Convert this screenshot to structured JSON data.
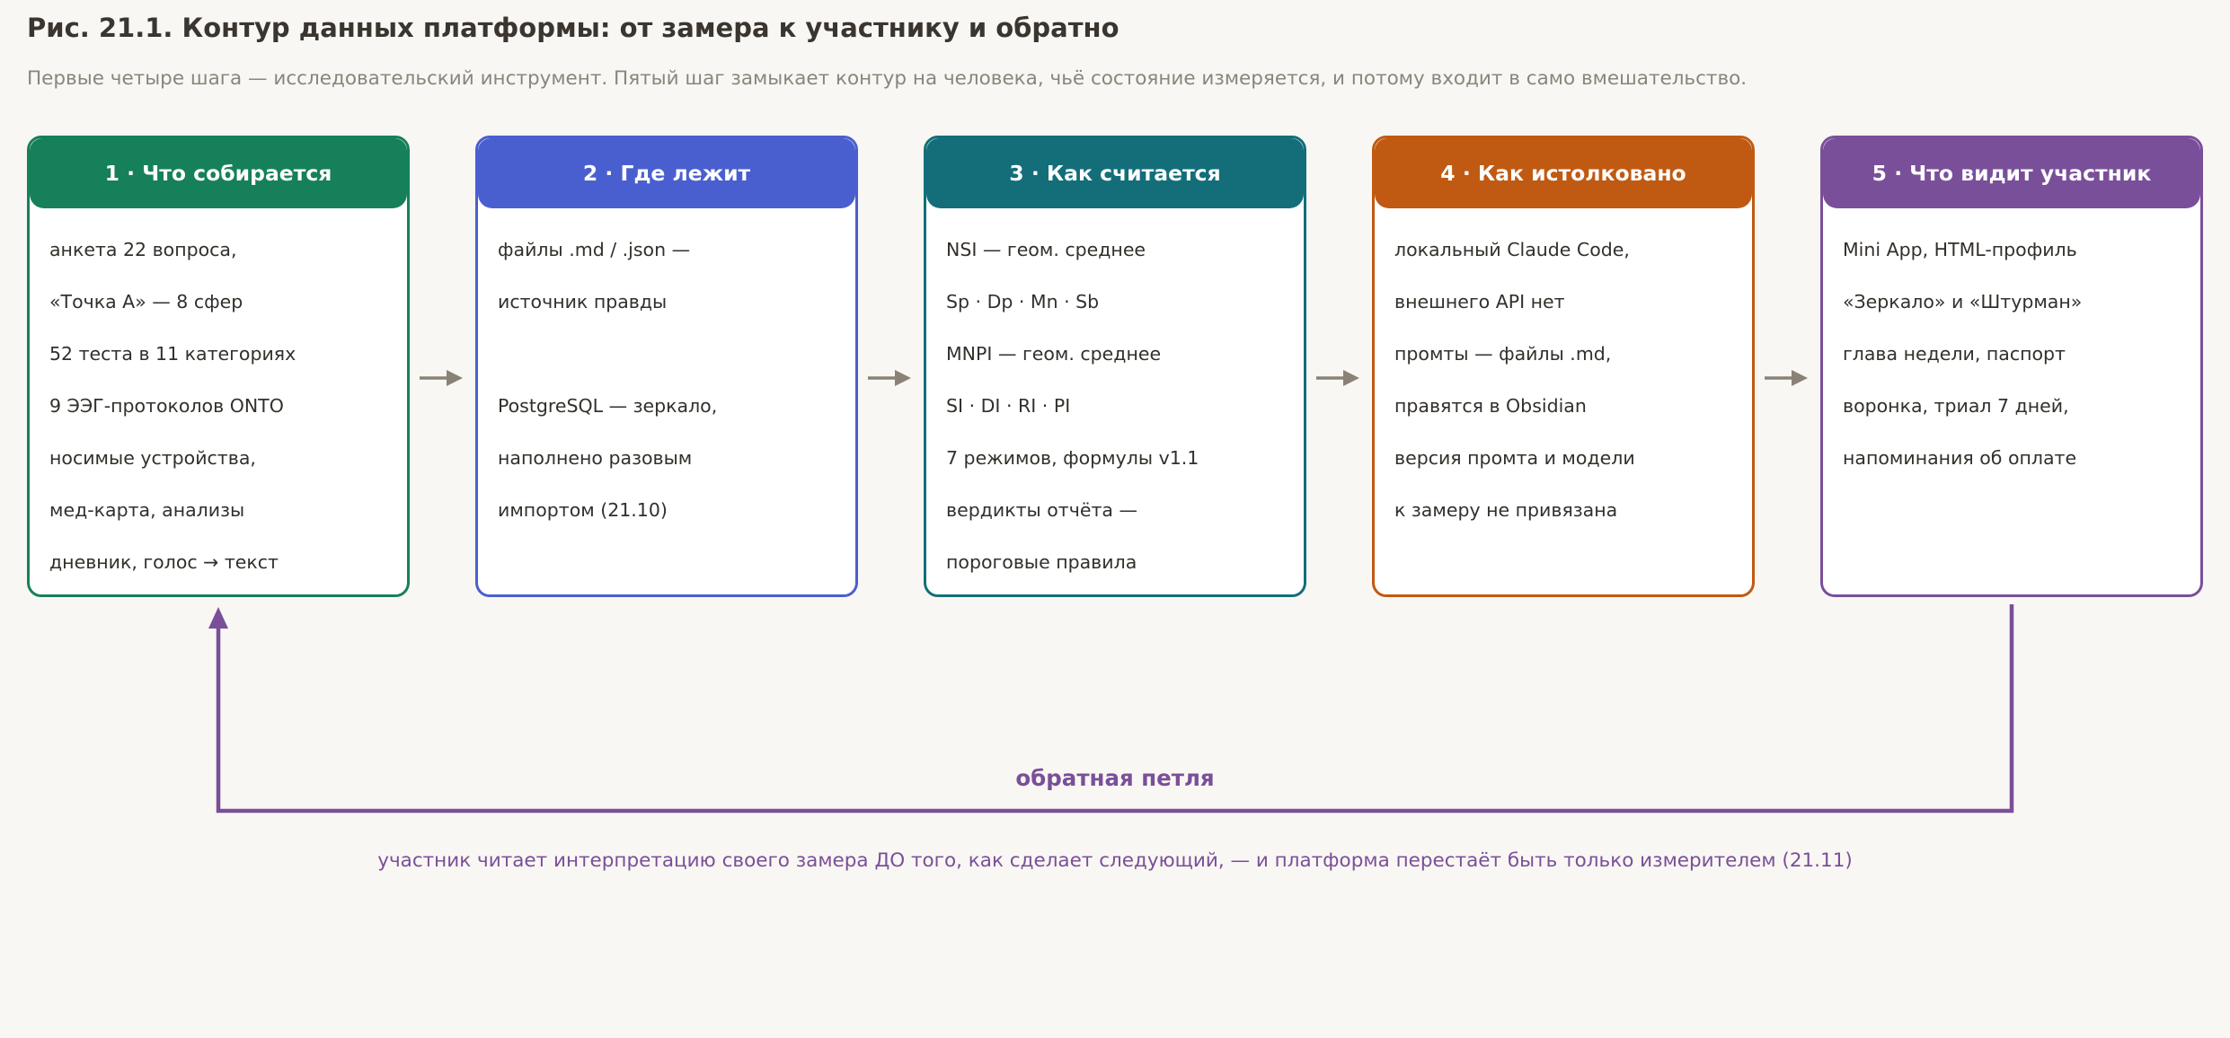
{
  "title": "Рис. 21.1. Контур данных платформы: от замера к участнику и обратно",
  "subtitle": "Первые четыре шага — исследовательский инструмент. Пятый шаг замыкает контур на человека, чьё состояние измеряется, и потому входит в само вмешательство.",
  "colors": {
    "step1": "#16805a",
    "step2": "#4a5fcf",
    "step3": "#136e7a",
    "step4": "#c05a12",
    "step5": "#7a4f9a",
    "arrow": "#8a8276",
    "loop": "#7a4f9a"
  },
  "steps": [
    {
      "title": "1 · Что собирается",
      "lines": [
        "анкета 22 вопроса,",
        "«Точка А» — 8 сфер",
        "52 теста в 11 категориях",
        "9 ЭЭГ-протоколов ONTO",
        "носимые устройства,",
        "мед-карта, анализы",
        "дневник, голос → текст"
      ]
    },
    {
      "title": "2 · Где лежит",
      "lines": [
        "файлы .md / .json —",
        "источник правды",
        "",
        "PostgreSQL — зеркало,",
        "наполнено разовым",
        "импортом (21.10)",
        ""
      ]
    },
    {
      "title": "3 · Как считается",
      "lines": [
        "NSI — геом. среднее",
        "Sp · Dp · Mn · Sb",
        "MNPI — геом. среднее",
        "SI · DI · RI · PI",
        "7 режимов, формулы v1.1",
        "вердикты отчёта —",
        "пороговые правила"
      ]
    },
    {
      "title": "4 · Как истолковано",
      "lines": [
        "локальный Claude Code,",
        "внешнего API нет",
        "промты — файлы .md,",
        "правятся в Obsidian",
        "версия промта и модели",
        "к замеру не привязана",
        ""
      ]
    },
    {
      "title": "5 · Что видит участник",
      "lines": [
        "Mini App, HTML-профиль",
        "«Зеркало» и «Штурман»",
        "глава недели, паспорт",
        "воронка, триал 7 дней,",
        "напоминания об оплате",
        "",
        ""
      ]
    }
  ],
  "feedback": {
    "label": "обратная петля",
    "caption": "участник читает интерпретацию своего замера ДО того, как сделает следующий, — и платформа перестаёт быть только измерителем (21.11)"
  }
}
